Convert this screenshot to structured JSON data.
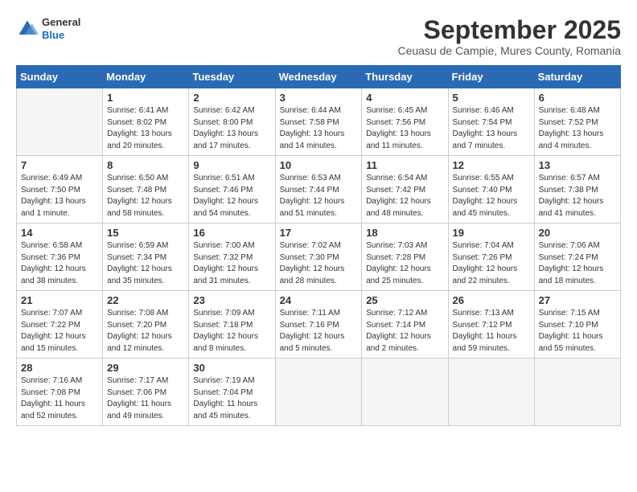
{
  "logo": {
    "general": "General",
    "blue": "Blue"
  },
  "title": "September 2025",
  "subtitle": "Ceuasu de Campie, Mures County, Romania",
  "days_of_week": [
    "Sunday",
    "Monday",
    "Tuesday",
    "Wednesday",
    "Thursday",
    "Friday",
    "Saturday"
  ],
  "weeks": [
    [
      {
        "day": "",
        "info": ""
      },
      {
        "day": "1",
        "info": "Sunrise: 6:41 AM\nSunset: 8:02 PM\nDaylight: 13 hours\nand 20 minutes."
      },
      {
        "day": "2",
        "info": "Sunrise: 6:42 AM\nSunset: 8:00 PM\nDaylight: 13 hours\nand 17 minutes."
      },
      {
        "day": "3",
        "info": "Sunrise: 6:44 AM\nSunset: 7:58 PM\nDaylight: 13 hours\nand 14 minutes."
      },
      {
        "day": "4",
        "info": "Sunrise: 6:45 AM\nSunset: 7:56 PM\nDaylight: 13 hours\nand 11 minutes."
      },
      {
        "day": "5",
        "info": "Sunrise: 6:46 AM\nSunset: 7:54 PM\nDaylight: 13 hours\nand 7 minutes."
      },
      {
        "day": "6",
        "info": "Sunrise: 6:48 AM\nSunset: 7:52 PM\nDaylight: 13 hours\nand 4 minutes."
      }
    ],
    [
      {
        "day": "7",
        "info": "Sunrise: 6:49 AM\nSunset: 7:50 PM\nDaylight: 13 hours\nand 1 minute."
      },
      {
        "day": "8",
        "info": "Sunrise: 6:50 AM\nSunset: 7:48 PM\nDaylight: 12 hours\nand 58 minutes."
      },
      {
        "day": "9",
        "info": "Sunrise: 6:51 AM\nSunset: 7:46 PM\nDaylight: 12 hours\nand 54 minutes."
      },
      {
        "day": "10",
        "info": "Sunrise: 6:53 AM\nSunset: 7:44 PM\nDaylight: 12 hours\nand 51 minutes."
      },
      {
        "day": "11",
        "info": "Sunrise: 6:54 AM\nSunset: 7:42 PM\nDaylight: 12 hours\nand 48 minutes."
      },
      {
        "day": "12",
        "info": "Sunrise: 6:55 AM\nSunset: 7:40 PM\nDaylight: 12 hours\nand 45 minutes."
      },
      {
        "day": "13",
        "info": "Sunrise: 6:57 AM\nSunset: 7:38 PM\nDaylight: 12 hours\nand 41 minutes."
      }
    ],
    [
      {
        "day": "14",
        "info": "Sunrise: 6:58 AM\nSunset: 7:36 PM\nDaylight: 12 hours\nand 38 minutes."
      },
      {
        "day": "15",
        "info": "Sunrise: 6:59 AM\nSunset: 7:34 PM\nDaylight: 12 hours\nand 35 minutes."
      },
      {
        "day": "16",
        "info": "Sunrise: 7:00 AM\nSunset: 7:32 PM\nDaylight: 12 hours\nand 31 minutes."
      },
      {
        "day": "17",
        "info": "Sunrise: 7:02 AM\nSunset: 7:30 PM\nDaylight: 12 hours\nand 28 minutes."
      },
      {
        "day": "18",
        "info": "Sunrise: 7:03 AM\nSunset: 7:28 PM\nDaylight: 12 hours\nand 25 minutes."
      },
      {
        "day": "19",
        "info": "Sunrise: 7:04 AM\nSunset: 7:26 PM\nDaylight: 12 hours\nand 22 minutes."
      },
      {
        "day": "20",
        "info": "Sunrise: 7:06 AM\nSunset: 7:24 PM\nDaylight: 12 hours\nand 18 minutes."
      }
    ],
    [
      {
        "day": "21",
        "info": "Sunrise: 7:07 AM\nSunset: 7:22 PM\nDaylight: 12 hours\nand 15 minutes."
      },
      {
        "day": "22",
        "info": "Sunrise: 7:08 AM\nSunset: 7:20 PM\nDaylight: 12 hours\nand 12 minutes."
      },
      {
        "day": "23",
        "info": "Sunrise: 7:09 AM\nSunset: 7:18 PM\nDaylight: 12 hours\nand 8 minutes."
      },
      {
        "day": "24",
        "info": "Sunrise: 7:11 AM\nSunset: 7:16 PM\nDaylight: 12 hours\nand 5 minutes."
      },
      {
        "day": "25",
        "info": "Sunrise: 7:12 AM\nSunset: 7:14 PM\nDaylight: 12 hours\nand 2 minutes."
      },
      {
        "day": "26",
        "info": "Sunrise: 7:13 AM\nSunset: 7:12 PM\nDaylight: 11 hours\nand 59 minutes."
      },
      {
        "day": "27",
        "info": "Sunrise: 7:15 AM\nSunset: 7:10 PM\nDaylight: 11 hours\nand 55 minutes."
      }
    ],
    [
      {
        "day": "28",
        "info": "Sunrise: 7:16 AM\nSunset: 7:08 PM\nDaylight: 11 hours\nand 52 minutes."
      },
      {
        "day": "29",
        "info": "Sunrise: 7:17 AM\nSunset: 7:06 PM\nDaylight: 11 hours\nand 49 minutes."
      },
      {
        "day": "30",
        "info": "Sunrise: 7:19 AM\nSunset: 7:04 PM\nDaylight: 11 hours\nand 45 minutes."
      },
      {
        "day": "",
        "info": ""
      },
      {
        "day": "",
        "info": ""
      },
      {
        "day": "",
        "info": ""
      },
      {
        "day": "",
        "info": ""
      }
    ]
  ]
}
